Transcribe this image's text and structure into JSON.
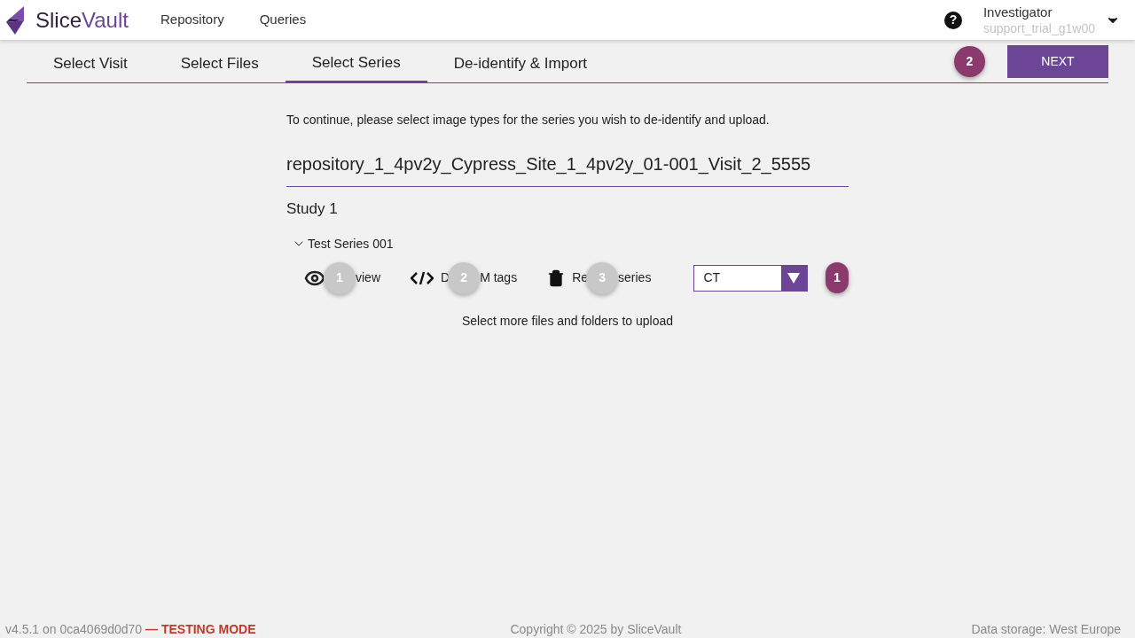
{
  "header": {
    "brand": {
      "part1": "Slice",
      "part2": "Vault"
    },
    "nav": [
      "Repository",
      "Queries"
    ],
    "help_icon": "?",
    "user": {
      "role": "Investigator",
      "account": "support_trial_g1w00"
    }
  },
  "steps": [
    {
      "label": "Select Visit",
      "selected": false
    },
    {
      "label": "Select Files",
      "selected": false
    },
    {
      "label": "Select Series",
      "selected": true
    },
    {
      "label": "De-identify & Import",
      "selected": false
    }
  ],
  "step_badge": "2",
  "next_button": "NEXT",
  "instruction": "To continue, please select image types for the series you wish to de-identify and upload.",
  "visit_name": "repository_1_4pv2y_Cypress_Site_1_4pv2y_01-001_Visit_2_5555",
  "study": "Study 1",
  "series": {
    "name": "Test Series 001",
    "expanded": true,
    "actions": [
      {
        "kind": "view",
        "badge": "1",
        "after": "view"
      },
      {
        "kind": "tags",
        "before": "D",
        "badge": "2",
        "after": "M tags"
      },
      {
        "kind": "remove",
        "before": "Re",
        "badge": "3",
        "after": "series"
      }
    ],
    "image_type": "CT",
    "type_badge": "1"
  },
  "more_files_link": "Select more files and folders to upload",
  "footer": {
    "version": "v4.5.1 on 0ca4069d0d70",
    "mode": "— TESTING MODE",
    "copyright": "Copyright © 2025 by SliceVault",
    "storage": "Data storage: West Europe"
  }
}
